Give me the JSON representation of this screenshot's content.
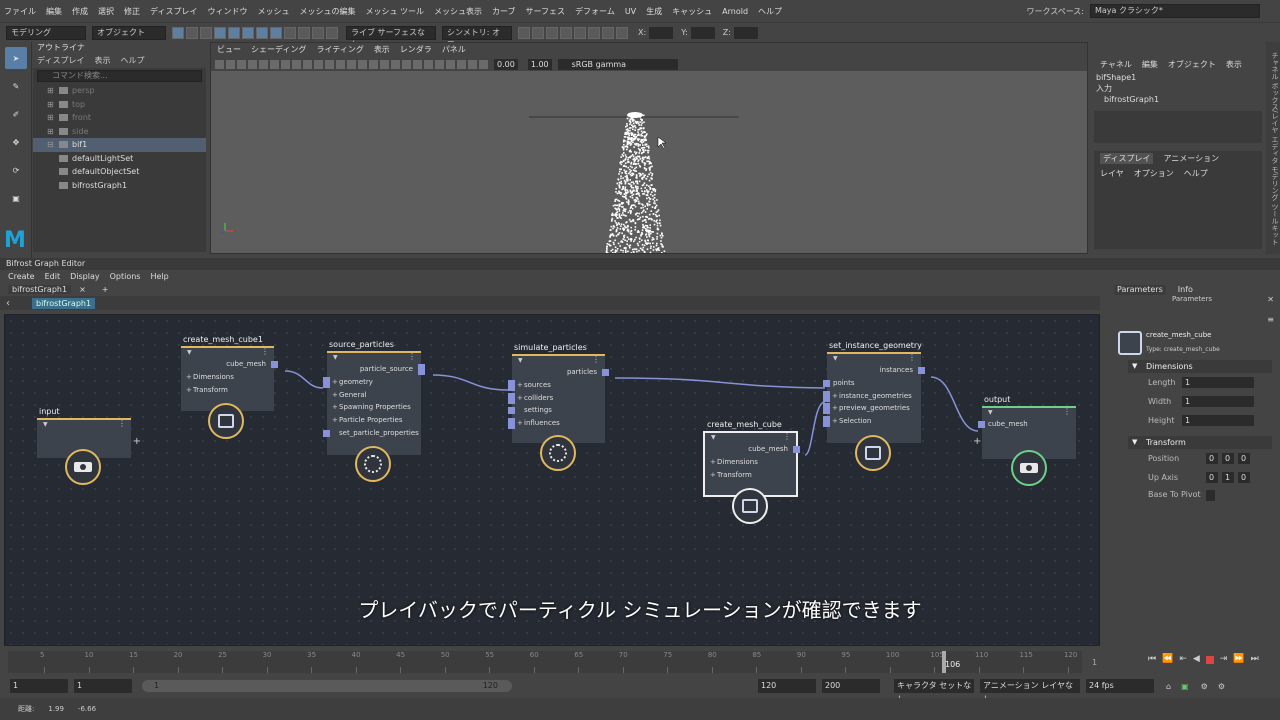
{
  "menubar": {
    "items": [
      "ファイル",
      "編集",
      "作成",
      "選択",
      "修正",
      "ディスプレイ",
      "ウィンドウ",
      "メッシュ",
      "メッシュの編集",
      "メッシュ ツール",
      "メッシュ表示",
      "カーブ",
      "サーフェス",
      "デフォーム",
      "UV",
      "生成",
      "キャッシュ",
      "Arnold",
      "ヘルプ"
    ],
    "workspace_label": "ワークスペース:",
    "workspace_value": "Maya クラシック*"
  },
  "statusline": {
    "mode": "モデリング",
    "object": "オブジェクト",
    "live": "ライブ サーフェスなし",
    "symmetry": "シンメトリ: オフ",
    "x": "X:",
    "y": "Y:",
    "z": "Z:"
  },
  "outliner": {
    "title": "アウトライナ",
    "menu": [
      "ディスプレイ",
      "表示",
      "ヘルプ"
    ],
    "search_placeholder": "コマンド検索...",
    "items": [
      {
        "label": "persp",
        "dim": true,
        "pm": "⊞"
      },
      {
        "label": "top",
        "dim": true,
        "pm": "⊞"
      },
      {
        "label": "front",
        "dim": true,
        "pm": "⊞"
      },
      {
        "label": "side",
        "dim": true,
        "pm": "⊞"
      },
      {
        "label": "bif1",
        "dim": false,
        "pm": "⊟",
        "selected": true
      },
      {
        "label": "defaultLightSet",
        "dim": false,
        "pm": ""
      },
      {
        "label": "defaultObjectSet",
        "dim": false,
        "pm": ""
      },
      {
        "label": "bifrostGraph1",
        "dim": false,
        "pm": ""
      }
    ]
  },
  "viewport": {
    "menu": [
      "ビュー",
      "シェーディング",
      "ライティング",
      "表示",
      "レンダラ",
      "パネル"
    ],
    "exposure": "0.00",
    "gamma": "1.00",
    "colorspace": "sRGB gamma"
  },
  "channelbox": {
    "tabs": [
      "チャネル",
      "編集",
      "オブジェクト",
      "表示"
    ],
    "shape": "bifShape1",
    "input_label": "入力",
    "input": "bifrostGraph1",
    "layer_tabs": [
      "ディスプレイ",
      "アニメーション"
    ],
    "layer_menu": [
      "レイヤ",
      "オプション",
      "ヘルプ"
    ]
  },
  "sidestrip": {
    "label": "チャネル ボックス/レイヤ エディタ   モデリング ツールキット"
  },
  "bge": {
    "title": "Bifrost Graph Editor",
    "menu": [
      "Create",
      "Edit",
      "Display",
      "Options",
      "Help"
    ],
    "tab": "bifrostGraph1",
    "tab_close": "×",
    "tab_add": "+",
    "crumb": "bifrostGraph1"
  },
  "nodes": {
    "input": {
      "title": "input"
    },
    "create_mesh_cube1": {
      "title": "create_mesh_cube1",
      "output": "cube_mesh",
      "params": [
        "Dimensions",
        "Transform"
      ]
    },
    "source_particles": {
      "title": "source_particles",
      "output": "particle_source",
      "params": [
        "geometry",
        "General",
        "Spawning Properties",
        "Particle Properties",
        "set_particle_properties"
      ]
    },
    "simulate_particles": {
      "title": "simulate_particles",
      "output": "particles",
      "params": [
        "sources",
        "colliders",
        "settings",
        "influences"
      ]
    },
    "create_mesh_cube": {
      "title": "create_mesh_cube",
      "output": "cube_mesh",
      "params": [
        "Dimensions",
        "Transform"
      ]
    },
    "set_instance_geometry": {
      "title": "set_instance_geometry",
      "output": "instances",
      "params": [
        "points",
        "instance_geometries",
        "preview_geometries",
        "Selection"
      ]
    },
    "output": {
      "title": "output",
      "params": [
        "cube_mesh"
      ]
    }
  },
  "subtitle": "プレイバックでパーティクル シミュレーションが確認できます",
  "params": {
    "tabs": [
      "Parameters",
      "Info"
    ],
    "header": "Parameters",
    "node_name": "create_mesh_cube",
    "node_type": "Type: create_mesh_cube",
    "sect_dimensions": "Dimensions",
    "length_label": "Length",
    "length": "1",
    "width_label": "Width",
    "width": "1",
    "height_label": "Height",
    "height": "1",
    "sect_transform": "Transform",
    "position_label": "Position",
    "position": [
      "0",
      "0",
      "0"
    ],
    "upaxis_label": "Up Axis",
    "upaxis": [
      "0",
      "1",
      "0"
    ],
    "basepivot_label": "Base To Pivot"
  },
  "timeline": {
    "ticks": [
      "5",
      "10",
      "15",
      "20",
      "25",
      "30",
      "35",
      "40",
      "45",
      "50",
      "55",
      "60",
      "65",
      "70",
      "75",
      "80",
      "85",
      "90",
      "95",
      "100",
      "105",
      "110",
      "115",
      "120"
    ],
    "current": "106",
    "current_field": "1"
  },
  "range": {
    "start": "1",
    "start2": "1",
    "slider_start": "1",
    "slider_end": "120",
    "end": "120",
    "end2": "200",
    "char_set": "キャラクタ セットなし",
    "anim_layer": "アニメーション レイヤなし",
    "fps": "24 fps"
  },
  "cmdline": {
    "label": "距離:",
    "v1": "1.99",
    "v2": "-6.66"
  }
}
